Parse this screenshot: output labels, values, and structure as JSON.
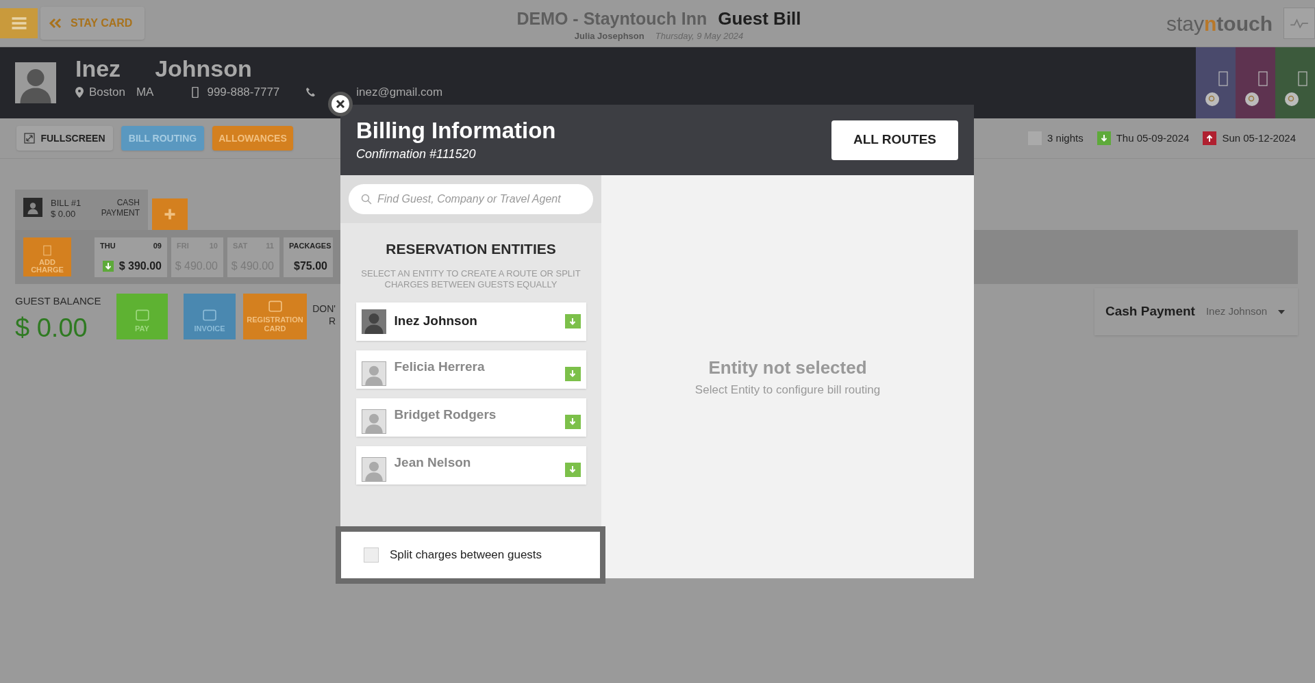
{
  "top_bar": {
    "back_label": "STAY CARD",
    "hotel": "DEMO - Stayntouch Inn",
    "page_title": "Guest Bill",
    "user": "Julia Josephson",
    "date": "Thursday, 9 May 2024",
    "logo_parts": [
      "stay",
      "n",
      "touch"
    ]
  },
  "guest": {
    "first_name": "Inez",
    "last_name": "Johnson",
    "city": "Boston",
    "state": "MA",
    "phone": "999-888-7777",
    "email": "inez@gmail.com"
  },
  "header_tiles": [
    {
      "color": "#4a4a6c"
    },
    {
      "color": "#5e3350"
    },
    {
      "color": "#3c5a3c"
    }
  ],
  "actions": [
    {
      "label": "FULLSCREEN",
      "kind": "plain"
    },
    {
      "label": "BILL ROUTING",
      "kind": "blue"
    },
    {
      "label": "ALLOWANCES",
      "kind": "orange"
    }
  ],
  "stay": {
    "nights": "3 nights",
    "arrival": "Thu 05-09-2024",
    "departure": "Sun 05-12-2024"
  },
  "bill_tab": {
    "label": "BILL #1",
    "amount": "$ 0.00",
    "payment": "CASH PAYMENT"
  },
  "add_charge": "ADD CHARGE",
  "days": [
    {
      "day": "THU",
      "num": "09",
      "amount": "$ 390.00",
      "active": true
    },
    {
      "day": "FRI",
      "num": "10",
      "amount": "$ 490.00",
      "active": false
    },
    {
      "day": "SAT",
      "num": "11",
      "amount": "$ 490.00",
      "active": false
    },
    {
      "day": "PACKAGES",
      "amount": "$75.00",
      "active": true
    }
  ],
  "balance": {
    "label": "GUEST BALANCE",
    "amount": "$ 0.00"
  },
  "bill_buttons": [
    {
      "label": "PAY",
      "kind": "pay"
    },
    {
      "label": "INVOICE",
      "kind": "invoice"
    },
    {
      "label": "REGISTRATION CARD",
      "kind": "registration"
    }
  ],
  "cut_text": [
    "DON'",
    "R"
  ],
  "payment_box": {
    "method": "Cash Payment",
    "guest": "Inez Johnson"
  },
  "modal": {
    "title": "Billing Information",
    "confirmation": "Confirmation #111520",
    "all_routes": "ALL ROUTES",
    "search": {
      "placeholder": "Find Guest, Company or Travel Agent"
    },
    "entities_title": "RESERVATION ENTITIES",
    "entities_hint": "SELECT AN ENTITY TO CREATE A ROUTE OR SPLIT CHARGES BETWEEN GUESTS EQUALLY",
    "entities": [
      {
        "name": "Inez Johnson",
        "selected": true
      },
      {
        "name": "Felicia Herrera",
        "selected": false
      },
      {
        "name": "Bridget Rodgers",
        "selected": false
      },
      {
        "name": "Jean Nelson",
        "selected": false
      }
    ],
    "split": {
      "label": "Split charges between guests",
      "checked": false
    },
    "empty_title": "Entity not selected",
    "empty_hint": "Select Entity to configure bill routing"
  }
}
